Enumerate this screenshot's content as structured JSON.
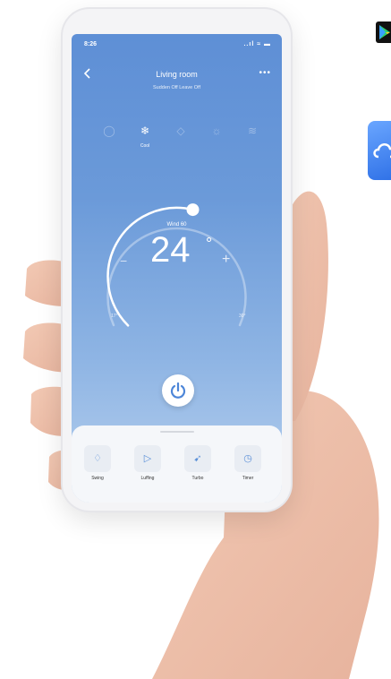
{
  "status": {
    "time": "8:26",
    "system_icons": "..ıl ≈ ▬"
  },
  "header": {
    "back_icon": "chevron-left-icon",
    "title": "Living room",
    "subtitle": "Sudden Off  Leave Off",
    "more_label": "•••"
  },
  "modes": [
    {
      "name": "auto",
      "icon": "auto-icon",
      "glyph": "◯",
      "label": ""
    },
    {
      "name": "cool",
      "icon": "snowflake-icon",
      "glyph": "❄",
      "label": "Cool"
    },
    {
      "name": "dry",
      "icon": "drop-icon",
      "glyph": "◇",
      "label": ""
    },
    {
      "name": "heat",
      "icon": "heat-icon",
      "glyph": "☼",
      "label": ""
    },
    {
      "name": "fan",
      "icon": "fan-icon",
      "glyph": "≋",
      "label": ""
    }
  ],
  "thermostat": {
    "wind_label": "Wind 60",
    "temperature": "24",
    "unit": "°",
    "minus_label": "−",
    "plus_label": "+",
    "min_label": "17°",
    "max_label": "30°",
    "level": 0.55
  },
  "functions": [
    {
      "label": "Swing",
      "icon": "swing-icon",
      "glyph": "♢"
    },
    {
      "label": "Luffing",
      "icon": "luffing-icon",
      "glyph": "▷"
    },
    {
      "label": "Turbo",
      "icon": "turbo-icon",
      "glyph": "➹"
    },
    {
      "label": "Timer",
      "icon": "clock-icon",
      "glyph": "◷"
    }
  ],
  "colors": {
    "screen_top": "#5e8fd6",
    "screen_bottom": "#b7d0ee",
    "accent": "#5a8fd8"
  }
}
